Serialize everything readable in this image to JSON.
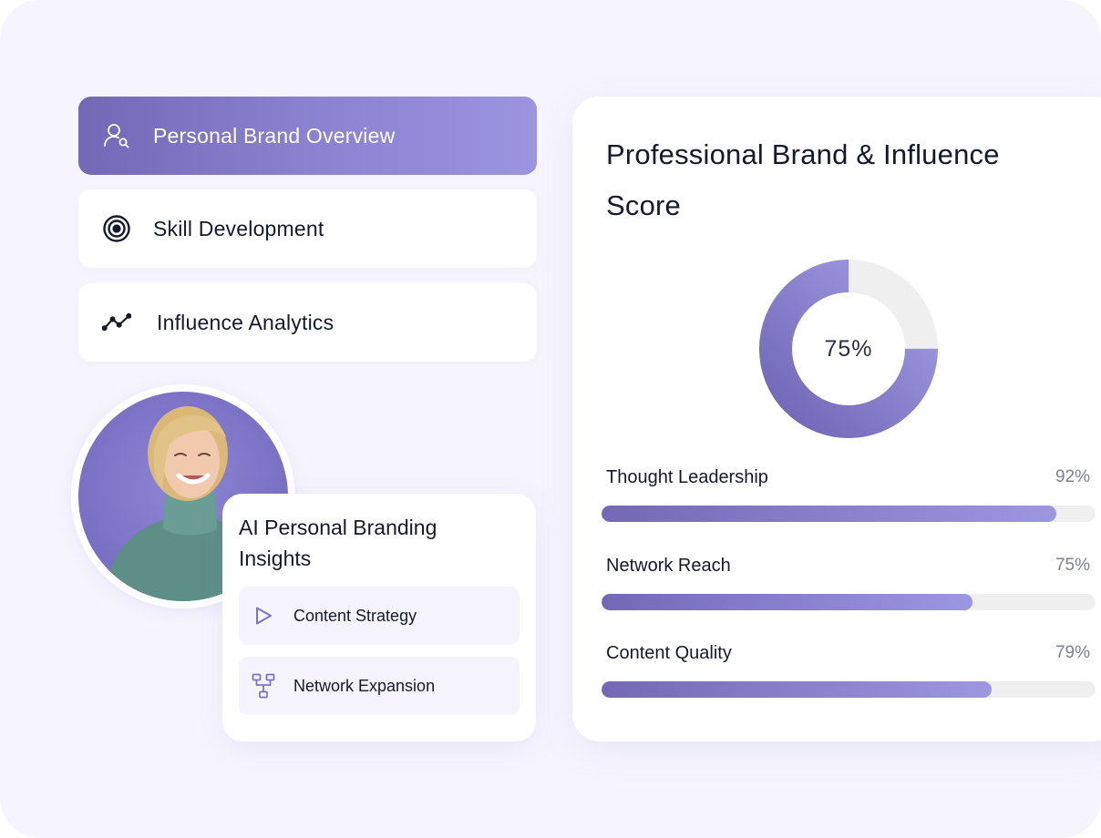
{
  "nav": {
    "items": [
      {
        "label": "Personal Brand Overview",
        "icon": "user-search-icon",
        "active": true
      },
      {
        "label": "Skill Development",
        "icon": "target-icon",
        "active": false
      },
      {
        "label": "Influence Analytics",
        "icon": "trend-line-icon",
        "active": false
      }
    ]
  },
  "insights": {
    "title": "AI Personal Branding Insights",
    "items": [
      {
        "label": "Content Strategy",
        "icon": "play-icon"
      },
      {
        "label": "Network Expansion",
        "icon": "network-tree-icon"
      }
    ]
  },
  "score": {
    "title": "Professional Brand & Influence Score",
    "donut_value": 0.75,
    "donut_label": "75%",
    "metrics": [
      {
        "label": "Thought Leadership",
        "value_text": "92%",
        "value": 0.92
      },
      {
        "label": "Network Reach",
        "value_text": "75%",
        "value": 0.75
      },
      {
        "label": "Content Quality",
        "value_text": "79%",
        "value": 0.79
      }
    ]
  },
  "colors": {
    "accent_start": "#7268b6",
    "accent_end": "#9b94df",
    "background": "#f6f5fd",
    "track": "#efefef"
  }
}
